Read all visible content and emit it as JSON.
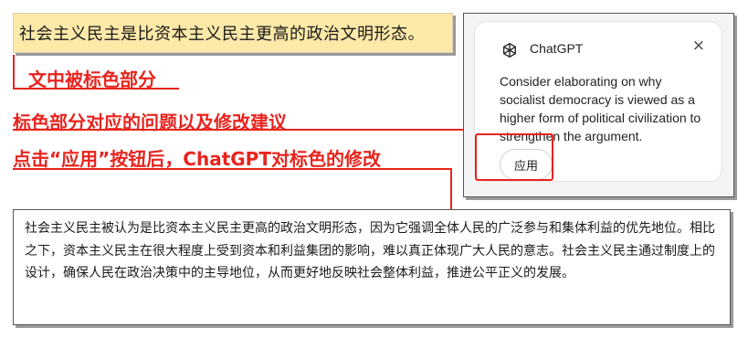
{
  "highlighted_sentence": "社会主义民主是比资本主义民主更高的政治文明形态。",
  "annotations": {
    "label_highlight": "文中被标色部分",
    "label_suggestion": "标色部分对应的问题以及修改建议",
    "label_after_apply": "点击“应用”按钮后，ChatGPT对标色的修改"
  },
  "suggestion_card": {
    "app_name": "ChatGPT",
    "close_glyph": "×",
    "icon": "openai-logo-icon",
    "suggestion": "Consider elaborating on why socialist democracy is viewed as a higher form of political civilization to strengthen the argument.",
    "apply_label": "应用"
  },
  "revised_paragraph": "社会主义民主被认为是比资本主义民主更高的政治文明形态，因为它强调全体人民的广泛参与和集体利益的优先地位。相比之下，资本主义民主在很大程度上受到资本和利益集团的影响，难以真正体现广大人民的意志。社会主义民主通过制度上的设计，确保人民在政治决策中的主导地位，从而更好地反映社会整体利益，推进公平正义的发展。",
  "colors": {
    "accent_red": "#e8241e",
    "highlight_yellow": "#fde9a8"
  }
}
